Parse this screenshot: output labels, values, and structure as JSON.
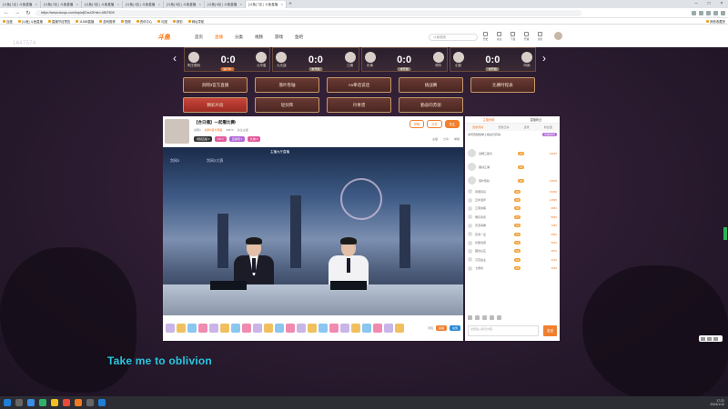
{
  "browser": {
    "tabs": [
      "[斗鱼] 1区 | 斗鱼直播",
      "[斗鱼] 2区 | 斗鱼直播",
      "[斗鱼] 3区 | 斗鱼直播",
      "[斗鱼] 4区 | 斗鱼直播",
      "[斗鱼] 5区 | 斗鱼直播",
      "[斗鱼] 6区 | 斗鱼直播",
      "[斗鱼] 7区 | 斗鱼直播"
    ],
    "active_tab": 6,
    "url": "https://www.douyu.com/topic/jiDxuOlHzh=4807609",
    "bookmarks": [
      "百度",
      "[斗鱼] 斗鱼直播",
      "直播节目预告",
      "11688直播",
      "游戏推荐",
      "视频",
      "资讯中心",
      "动漫",
      "精彩",
      "网址导航"
    ],
    "bookmarks_right": "其他收藏夹"
  },
  "site": {
    "logo": "斗鱼",
    "nav": [
      "首页",
      "直播",
      "分类",
      "视频",
      "游戏",
      "鱼吧"
    ],
    "nav_active": 1,
    "search_placeholder": "斗鱼搜索",
    "header_icons": [
      "历史",
      "关注",
      "下载",
      "开播",
      "消息"
    ],
    "side_counter": "1647574"
  },
  "matches": [
    {
      "team_a": "明王御剑",
      "team_b": "九华星",
      "score": "0:0",
      "tag": "进行中"
    },
    {
      "team_a": "九天曲",
      "team_b": "江湖",
      "score": "0:0",
      "tag": "未开始"
    },
    {
      "team_a": "乐事",
      "team_b": "明华",
      "score": "0:0",
      "tag": "未开始"
    },
    {
      "team_a": "幻影",
      "team_b": "听雨",
      "score": "0:0",
      "tag": "未开始"
    }
  ],
  "grid_buttons": [
    "剑网3官方直播",
    "落叶卷轴",
    "As拳话说话",
    "挑战赛",
    "比赛时程表",
    "精彩片段",
    "轻剑阵",
    "丹青谱",
    "勤奋的苏丽",
    ""
  ],
  "room": {
    "title": "【合日播】一起看比赛!",
    "meta": [
      "剑网3",
      "剑网3官方赛事",
      "98876",
      "关注主播"
    ],
    "badges": [
      "视频直播 ▾",
      "PK ▾",
      "直播吧 ▾",
      "礼物 ▾"
    ],
    "follow": "关注",
    "report": "举报",
    "share": "分享",
    "links": [
      "主播",
      "分享",
      "举报"
    ],
    "video_banner": "主播大厅直播",
    "video_logo_a": "剑网3",
    "video_logo_b": "剑网3大赛",
    "gift_actions": [
      "投喂",
      "背包",
      "充值"
    ]
  },
  "chat": {
    "tabs": [
      "主播贡献",
      "直播粉丝"
    ],
    "sub_tabs": [
      "贡献周榜",
      "贡献日榜",
      "贵宾",
      "粉丝团"
    ],
    "notice": "本周贡献榜单上榜后可获得",
    "notice_badge": "查看规则",
    "ranks": [
      {
        "name": "剑网三官方",
        "level": "23",
        "value": "19266"
      },
      {
        "name": "御剑江湖",
        "level": "21",
        "value": ""
      },
      {
        "name": "落叶知秋",
        "level": "20",
        "value": "16508"
      },
      {
        "name": "风雨同舟",
        "level": "19",
        "value": "15390"
      },
      {
        "name": "云中漫步",
        "level": "18",
        "value": "12895"
      },
      {
        "name": "江南剑客",
        "level": "18",
        "value": "9830"
      },
      {
        "name": "明月清风",
        "level": "17",
        "value": "8650"
      },
      {
        "name": "天涯海角",
        "level": "16",
        "value": "7280"
      },
      {
        "name": "花间一壶",
        "level": "16",
        "value": "6890"
      },
      {
        "name": "长歌当哭",
        "level": "15",
        "value": "5540"
      },
      {
        "name": "藏剑山庄",
        "level": "14",
        "value": "4870"
      },
      {
        "name": "万花谷主",
        "level": "14",
        "value": "4315"
      },
      {
        "name": "七秀坊",
        "level": "13",
        "value": "3920"
      }
    ],
    "input_placeholder": "这里输入聊天内容",
    "send_label": "发送"
  },
  "subtitle": "Take me to oblivion",
  "taskbar_clock": [
    "17:21",
    "2024/1/12"
  ],
  "colors": {
    "brand": "#ff6a00",
    "subtitle": "#27c7e0",
    "page_bg": "#2a1a2e"
  }
}
